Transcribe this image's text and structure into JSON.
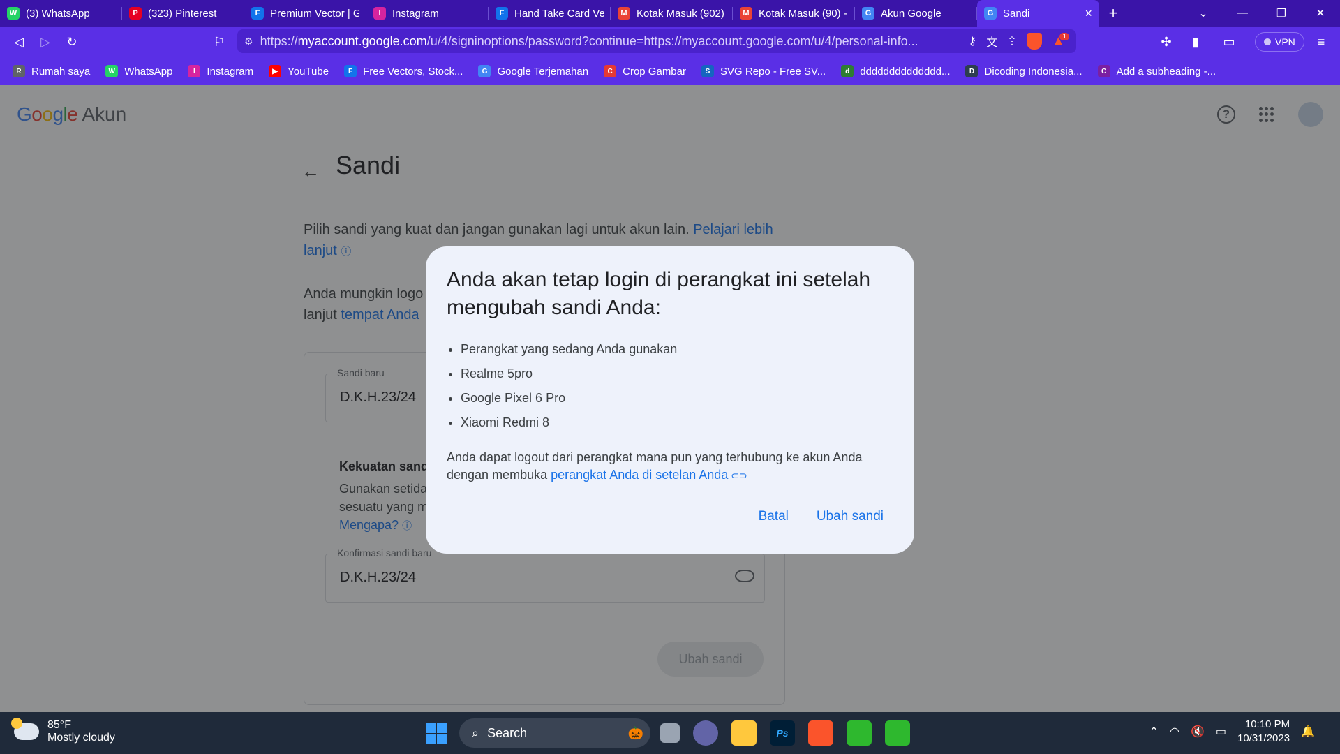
{
  "tabs": [
    {
      "title": "(3) WhatsApp",
      "color": "#25d366",
      "glyph": "W"
    },
    {
      "title": "(323) Pinterest",
      "color": "#e60023",
      "glyph": "P"
    },
    {
      "title": "Premium Vector | G",
      "color": "#1273eb",
      "glyph": "F"
    },
    {
      "title": "Instagram",
      "color": "#d6249f",
      "glyph": "I"
    },
    {
      "title": "Hand Take Card Ve",
      "color": "#1273eb",
      "glyph": "F"
    },
    {
      "title": "Kotak Masuk (902)",
      "color": "#ea4335",
      "glyph": "M"
    },
    {
      "title": "Kotak Masuk (90) -",
      "color": "#ea4335",
      "glyph": "M"
    },
    {
      "title": "Akun Google",
      "color": "#4285f4",
      "glyph": "G"
    },
    {
      "title": "Sandi",
      "color": "#4285f4",
      "glyph": "G",
      "active": true
    }
  ],
  "address": {
    "prefix": "https://",
    "host": "myaccount.google.com",
    "path": "/u/4/signinoptions/password?continue=https://myaccount.google.com/u/4/personal-info...",
    "vpn": "VPN",
    "shield_badge": "1"
  },
  "bookmarks": [
    {
      "label": "Rumah saya",
      "color": "#5f6368",
      "glyph": "R"
    },
    {
      "label": "WhatsApp",
      "color": "#25d366",
      "glyph": "W"
    },
    {
      "label": "Instagram",
      "color": "#d6249f",
      "glyph": "I"
    },
    {
      "label": "YouTube",
      "color": "#ff0000",
      "glyph": "▶"
    },
    {
      "label": "Free Vectors, Stock...",
      "color": "#1273eb",
      "glyph": "F"
    },
    {
      "label": "Google Terjemahan",
      "color": "#4285f4",
      "glyph": "G"
    },
    {
      "label": "Crop Gambar",
      "color": "#e53935",
      "glyph": "C"
    },
    {
      "label": "SVG Repo - Free SV...",
      "color": "#1565c0",
      "glyph": "S"
    },
    {
      "label": "dddddddddddddd...",
      "color": "#2e7d32",
      "glyph": "d"
    },
    {
      "label": "Dicoding Indonesia...",
      "color": "#2d3e50",
      "glyph": "D"
    },
    {
      "label": "Add a subheading -...",
      "color": "#7b1fa2",
      "glyph": "C"
    }
  ],
  "google": {
    "logo": "Google",
    "product": "Akun"
  },
  "page": {
    "title": "Sandi",
    "intro": "Pilih sandi yang kuat dan jangan gunakan lagi untuk akun lain.",
    "intro_link": "Pelajari lebih lanjut",
    "logout_text": "Anda mungkin logo",
    "logout_text2": "lanjut",
    "logout_link": "tempat Anda",
    "new_password_label": "Sandi baru",
    "new_password_value": "D.K.H.23/24",
    "strength_title": "Kekuatan sandi",
    "strength_line1": "Gunakan setida",
    "strength_line2": "sesuatu yang m",
    "why_link": "Mengapa?",
    "confirm_label": "Konfirmasi sandi baru",
    "confirm_value": "D.K.H.23/24",
    "submit_label": "Ubah sandi"
  },
  "dialog": {
    "title": "Anda akan tetap login di perangkat ini setelah mengubah sandi Anda:",
    "devices": [
      "Perangkat yang sedang Anda gunakan",
      "Realme 5pro",
      "Google Pixel 6 Pro",
      "Xiaomi Redmi 8"
    ],
    "note": "Anda dapat logout dari perangkat mana pun yang terhubung ke akun Anda dengan membuka",
    "note_link": "perangkat Anda di setelan Anda",
    "cancel_label": "Batal",
    "confirm_label": "Ubah sandi"
  },
  "taskbar": {
    "temperature": "85°F",
    "weather": "Mostly cloudy",
    "search": "Search",
    "time": "10:10 PM",
    "date": "10/31/2023"
  }
}
